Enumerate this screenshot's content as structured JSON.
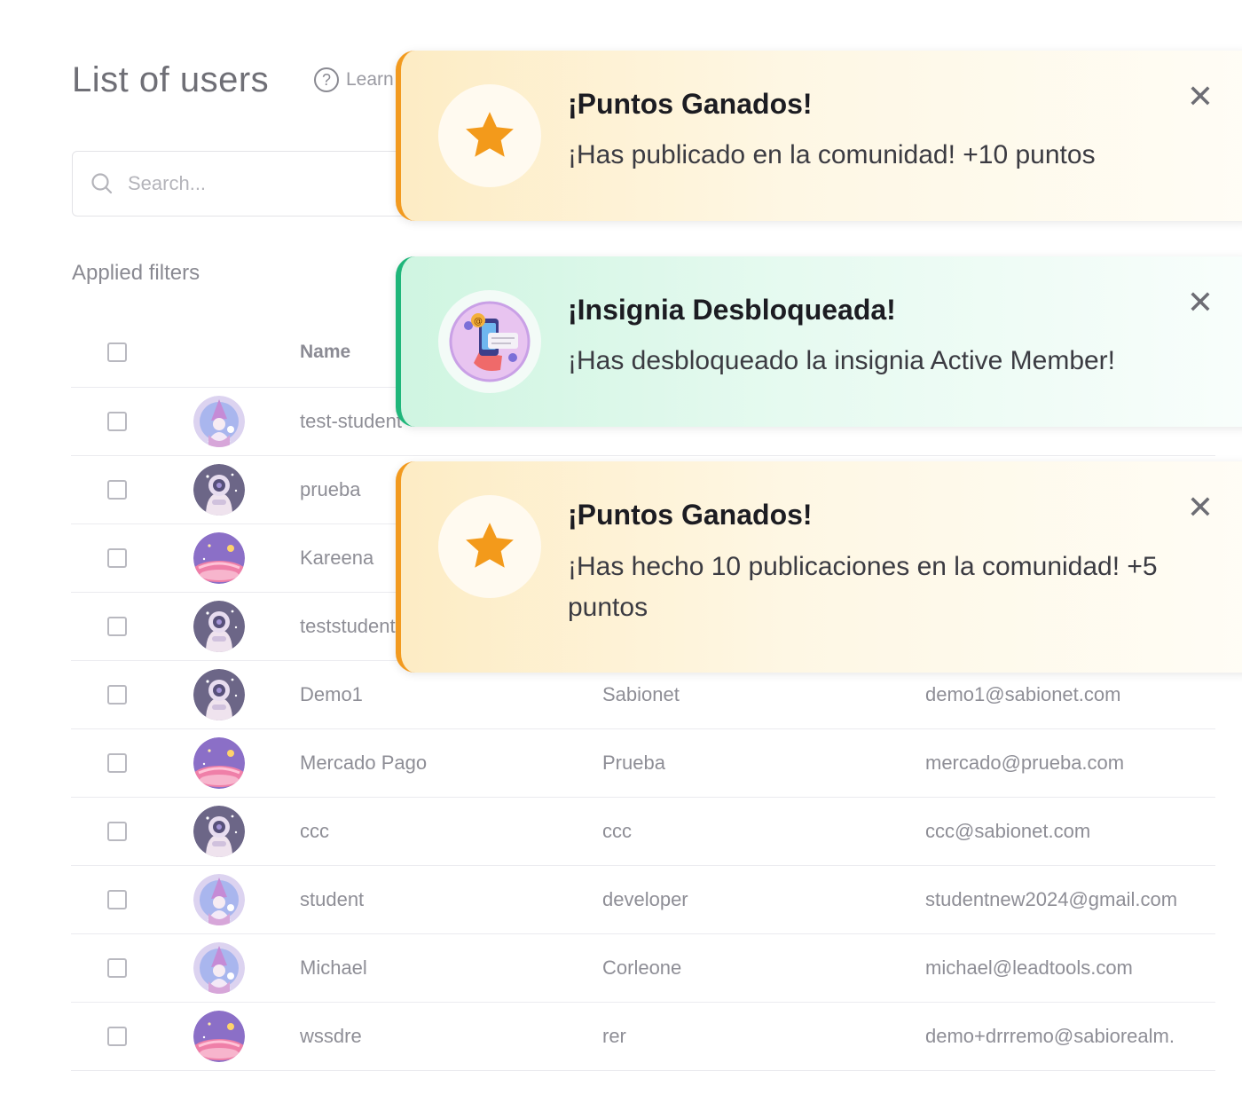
{
  "header": {
    "title": "List of users",
    "learn_label": "Learn",
    "help_glyph": "?"
  },
  "search": {
    "placeholder": "Search..."
  },
  "filters": {
    "label": "Applied filters"
  },
  "table": {
    "columns": [
      "Name"
    ],
    "rows": [
      {
        "name": "test-student",
        "last_name": "",
        "email": "",
        "avatar": "wizard-icon"
      },
      {
        "name": "prueba",
        "last_name": "",
        "email": "",
        "avatar": "astronaut-icon"
      },
      {
        "name": "Kareena",
        "last_name": "",
        "email": "",
        "avatar": "planet-icon"
      },
      {
        "name": "teststudent",
        "last_name": "",
        "email": "",
        "avatar": "astronaut-icon"
      },
      {
        "name": "Demo1",
        "last_name": "Sabionet",
        "email": "demo1@sabionet.com",
        "avatar": "astronaut-icon"
      },
      {
        "name": "Mercado Pago",
        "last_name": "Prueba",
        "email": "mercado@prueba.com",
        "avatar": "planet-icon"
      },
      {
        "name": "ccc",
        "last_name": "ccc",
        "email": "ccc@sabionet.com",
        "avatar": "astronaut-icon"
      },
      {
        "name": "student",
        "last_name": "developer",
        "email": "studentnew2024@gmail.com",
        "avatar": "wizard-icon"
      },
      {
        "name": "Michael",
        "last_name": "Corleone",
        "email": "michael@leadtools.com",
        "avatar": "wizard-icon"
      },
      {
        "name": "wssdre",
        "last_name": "rer",
        "email": "demo+drrremo@sabiorealm.",
        "avatar": "planet-icon"
      }
    ]
  },
  "toasts": [
    {
      "title": "¡Puntos Ganados!",
      "message": "¡Has publicado en la comunidad! +10 puntos",
      "icon": "star-icon",
      "close": "✕"
    },
    {
      "title": "¡Insignia Desbloqueada!",
      "message": "¡Has desbloqueado la insignia Active Member!",
      "icon": "badge-icon",
      "close": "✕"
    },
    {
      "title": "¡Puntos Ganados!",
      "message": "¡Has hecho 10 publicaciones en la comunidad! +5 puntos",
      "icon": "star-icon",
      "close": "✕"
    }
  ],
  "colors": {
    "points_accent": "#f29a1f",
    "badge_accent": "#1fb67a",
    "star": "#f39a1b"
  }
}
